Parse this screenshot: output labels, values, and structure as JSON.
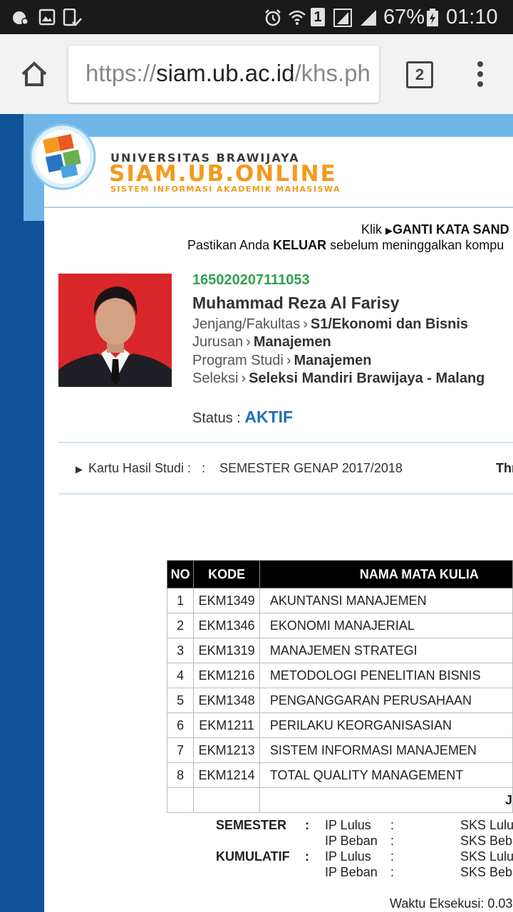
{
  "status_bar": {
    "battery": "67%",
    "time": "01:10",
    "sim_badge": "1"
  },
  "browser": {
    "url_scheme": "https://",
    "url_host": "siam.ub.ac.id",
    "url_path": "/khs.ph",
    "tab_count": "2"
  },
  "header": {
    "university": "UNIVERSITAS BRAWIJAYA",
    "system_name": "SIAM.UB.ONLINE",
    "system_subtitle": "SISTEM INFORMASI AKADEMIK MAHASISWA"
  },
  "notices": {
    "line1_pre": "Klik",
    "line1_link": "GANTI KATA SAND",
    "line2_pre": "Pastikan Anda",
    "line2_bold": "KELUAR",
    "line2_post": "sebelum meninggalkan kompu"
  },
  "student": {
    "nim": "165020207111053",
    "name": "Muhammad Reza Al Farisy",
    "fields": [
      {
        "label": "Jenjang/Fakultas",
        "value": "S1/Ekonomi dan Bisnis"
      },
      {
        "label": "Jurusan",
        "value": "Manajemen"
      },
      {
        "label": "Program Studi",
        "value": "Manajemen"
      },
      {
        "label": "Seleksi",
        "value": "Seleksi Mandiri Brawijaya - Malang"
      }
    ],
    "status_label": "Status :",
    "status_value": "AKTIF"
  },
  "khs": {
    "label": "Kartu Hasil Studi :",
    "colon": ":",
    "semester": "SEMESTER GENAP 2017/2018",
    "right_text": "Thr"
  },
  "table": {
    "headers": [
      "NO",
      "KODE",
      "NAMA MATA KULIA"
    ],
    "rows": [
      {
        "no": "1",
        "kode": "EKM1349",
        "nama": "AKUNTANSI MANAJEMEN"
      },
      {
        "no": "2",
        "kode": "EKM1346",
        "nama": "EKONOMI MANAJERIAL"
      },
      {
        "no": "3",
        "kode": "EKM1319",
        "nama": "MANAJEMEN STRATEGI"
      },
      {
        "no": "4",
        "kode": "EKM1216",
        "nama": "METODOLOGI PENELITIAN BISNIS"
      },
      {
        "no": "5",
        "kode": "EKM1348",
        "nama": "PENGANGGARAN PERUSAHAAN"
      },
      {
        "no": "6",
        "kode": "EKM1211",
        "nama": "PERILAKU KEORGANISASIAN"
      },
      {
        "no": "7",
        "kode": "EKM1213",
        "nama": "SISTEM INFORMASI MANAJEMEN"
      },
      {
        "no": "8",
        "kode": "EKM1214",
        "nama": "TOTAL QUALITY MANAGEMENT"
      }
    ],
    "footer_partial": "J"
  },
  "summary": {
    "semester_label": "SEMESTER",
    "kumulatif_label": "KUMULATIF",
    "colon": ":",
    "ip_lulus": "IP Lulus",
    "ip_beban": "IP Beban",
    "sks_lulus": "SKS Lulu",
    "sks_beban": "SKS Beba"
  },
  "footer": {
    "exec_time": "Waktu Eksekusi: 0.03"
  }
}
